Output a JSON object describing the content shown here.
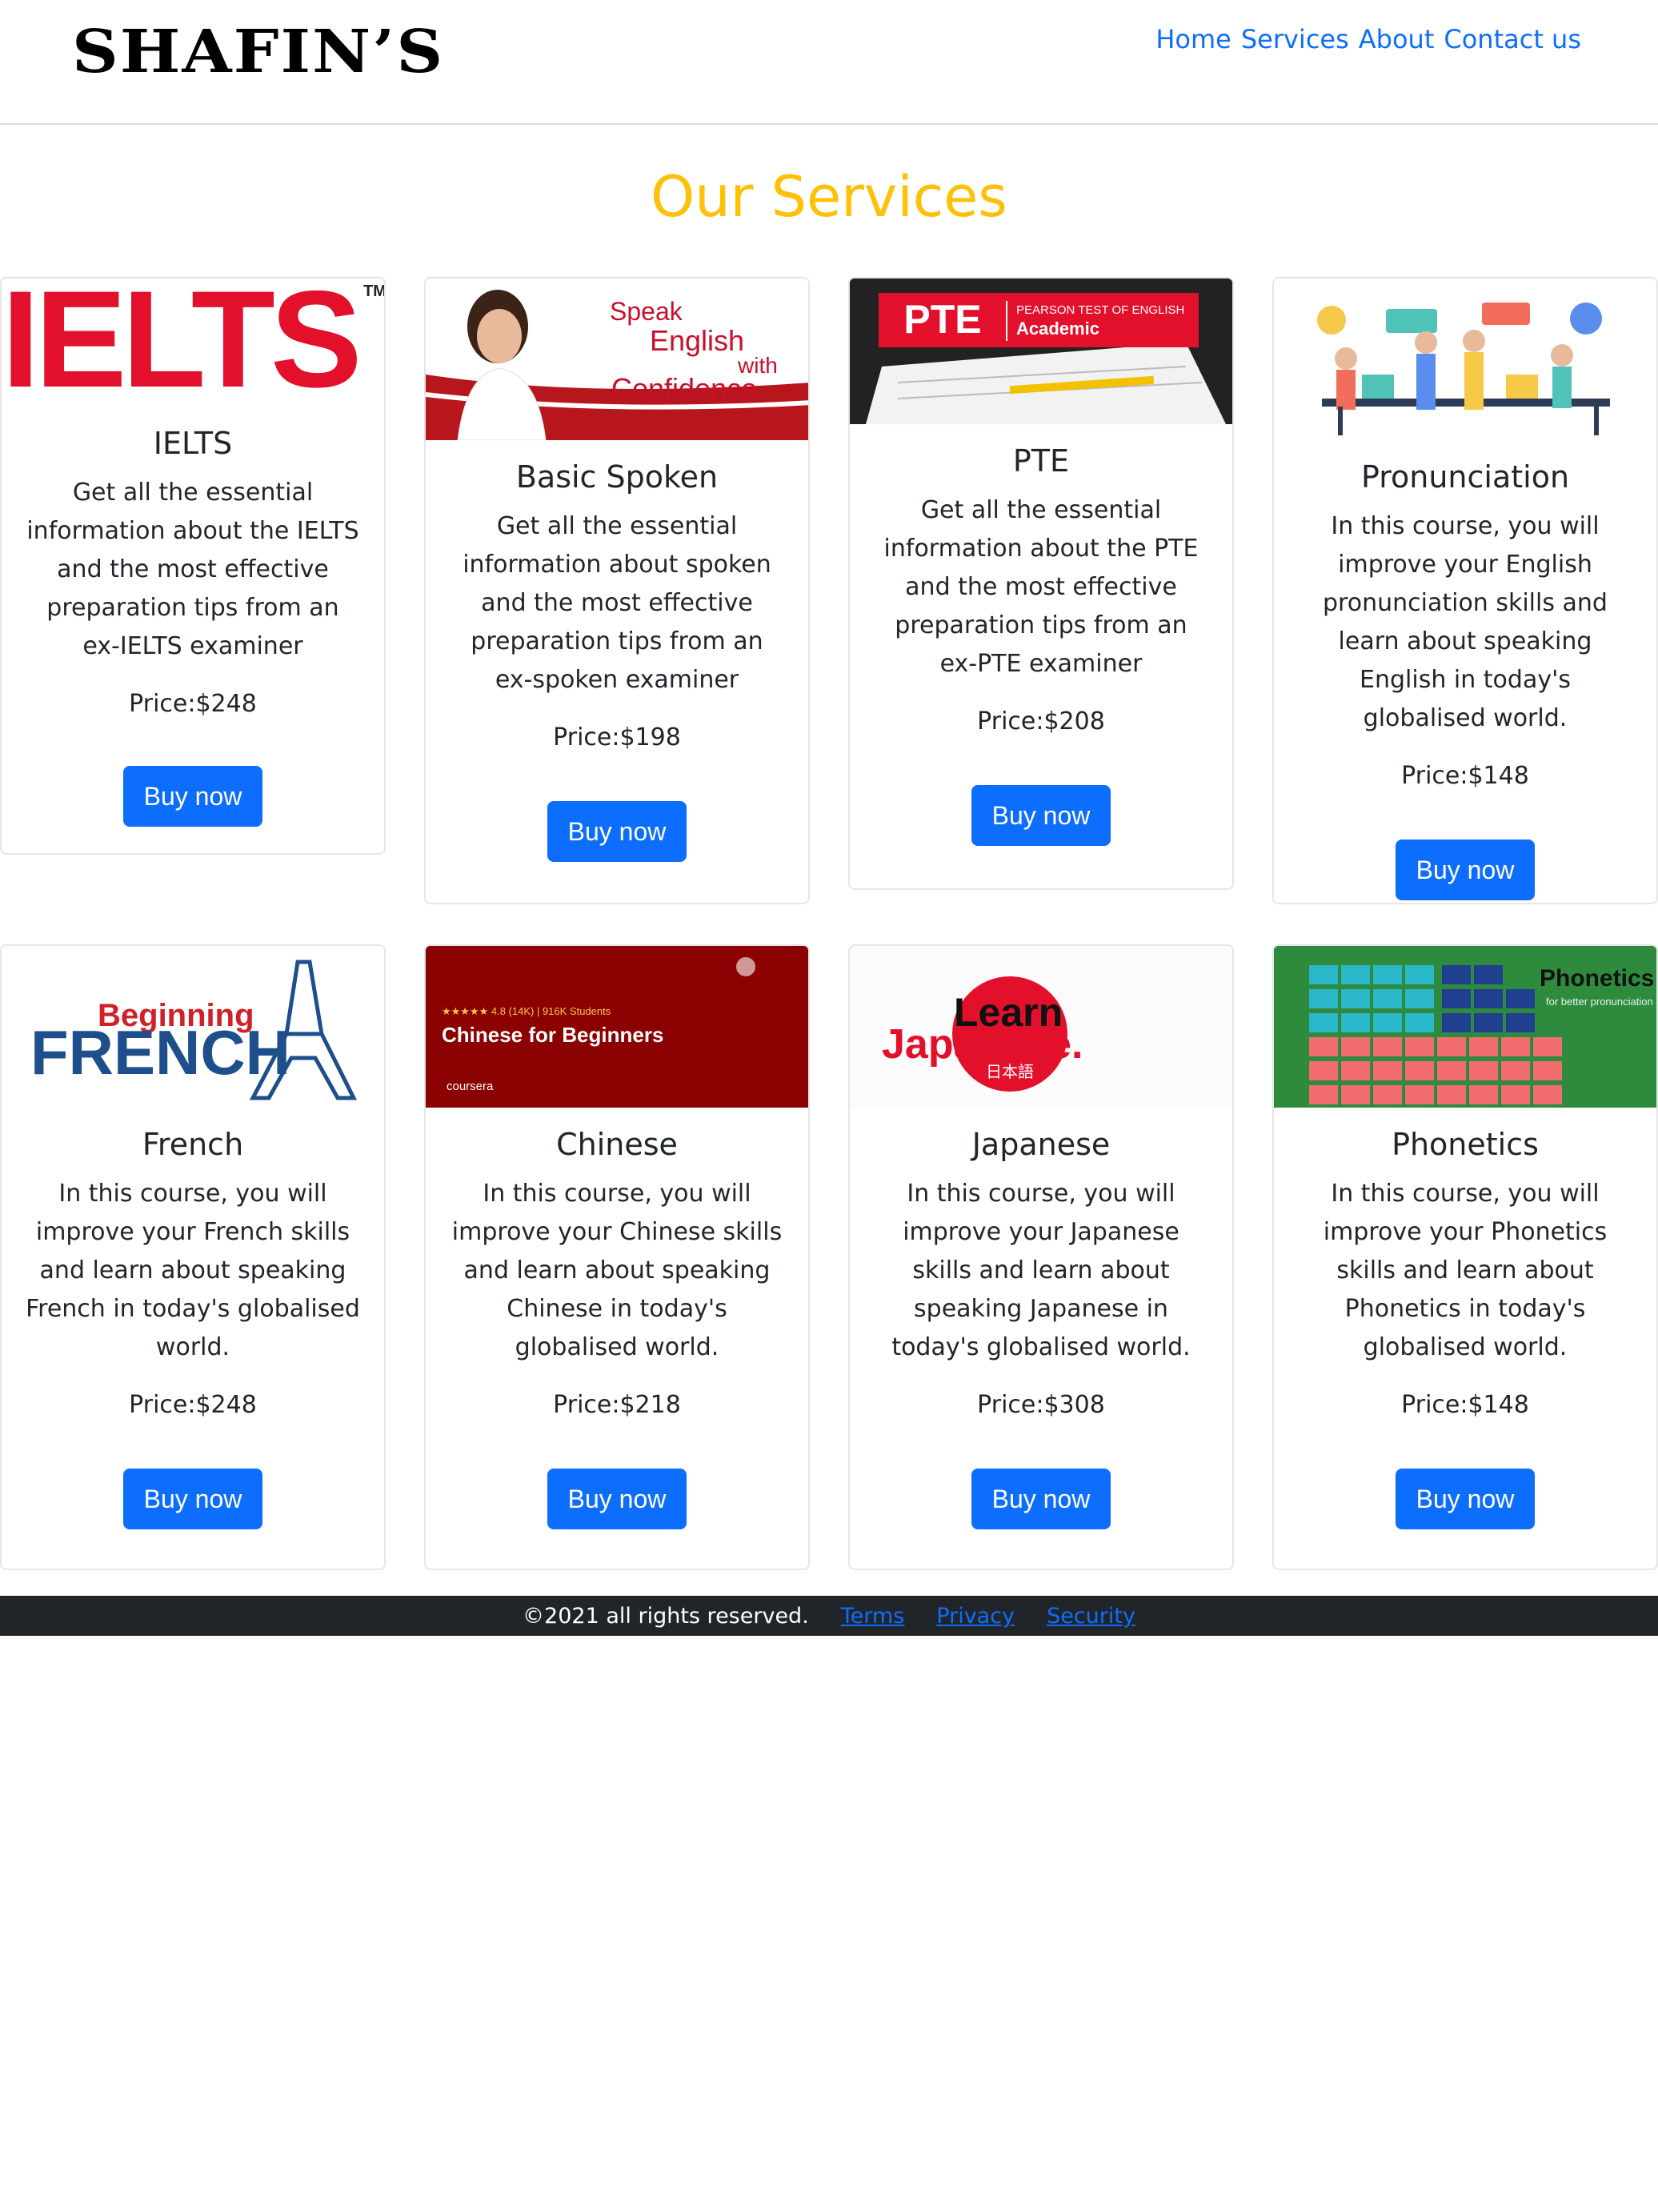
{
  "header": {
    "logo": "SHAFIN’S",
    "nav": [
      "Home",
      "Services",
      "About",
      "Contact us"
    ]
  },
  "main": {
    "title": "Our Services",
    "cards": [
      {
        "name": "IELTS",
        "desc": "Get all the essential information about the IELTS and the most effective preparation tips from an ex-IELTS examiner",
        "price": "Price:$248",
        "button": "Buy now",
        "image_text": "IELTS"
      },
      {
        "name": "Basic Spoken",
        "desc": "Get all the essential information about spoken and the most effective preparation tips from an ex-spoken examiner",
        "price": "Price:$198",
        "button": "Buy now",
        "image_text": "Speak English with Confidence"
      },
      {
        "name": "PTE",
        "desc": "Get all the essential information about the PTE and the most effective preparation tips from an ex-PTE examiner",
        "price": "Price:$208",
        "button": "Buy now",
        "image_text": "PTE",
        "image_sub1": "PEARSON TEST OF ENGLISH",
        "image_sub2": "Academic"
      },
      {
        "name": "Pronunciation",
        "desc": "In this course, you will improve your English pronunciation skills and learn about speaking English in today's globalised world.",
        "price": "Price:$148",
        "button": "Buy now"
      },
      {
        "name": "French",
        "desc": "In this course, you will improve your French skills and learn about speaking French in today's globalised world.",
        "price": "Price:$248",
        "button": "Buy now",
        "image_text1": "Beginning",
        "image_text2": "FRENCH"
      },
      {
        "name": "Chinese",
        "desc": "In this course, you will improve your Chinese skills and learn about speaking Chinese in today's globalised world.",
        "price": "Price:$218",
        "button": "Buy now",
        "image_meta": "★★★★★ 4.8 (14K) | 916K Students",
        "image_text": "Chinese for Beginners",
        "image_brand": "coursera"
      },
      {
        "name": "Japanese",
        "desc": "In this course, you will improve your Japanese skills and learn about speaking Japanese in today's globalised world.",
        "price": "Price:$308",
        "button": "Buy now",
        "image_text1": "Learn",
        "image_text2": "Japanese.",
        "image_text3": "日本語"
      },
      {
        "name": "Phonetics",
        "desc": "In this course, you will improve your Phonetics skills and learn about Phonetics in today's globalised world.",
        "price": "Price:$148",
        "button": "Buy now",
        "image_text": "Phonetics",
        "image_sub": "for better pronunciation & fluency"
      }
    ]
  },
  "footer": {
    "copyright": "©2021 all rights reserved.",
    "links": [
      "Terms",
      "Privacy",
      "Security"
    ]
  },
  "colors": {
    "accent": "#0d6efd",
    "title": "#ffc107",
    "footer_bg": "#212529"
  }
}
